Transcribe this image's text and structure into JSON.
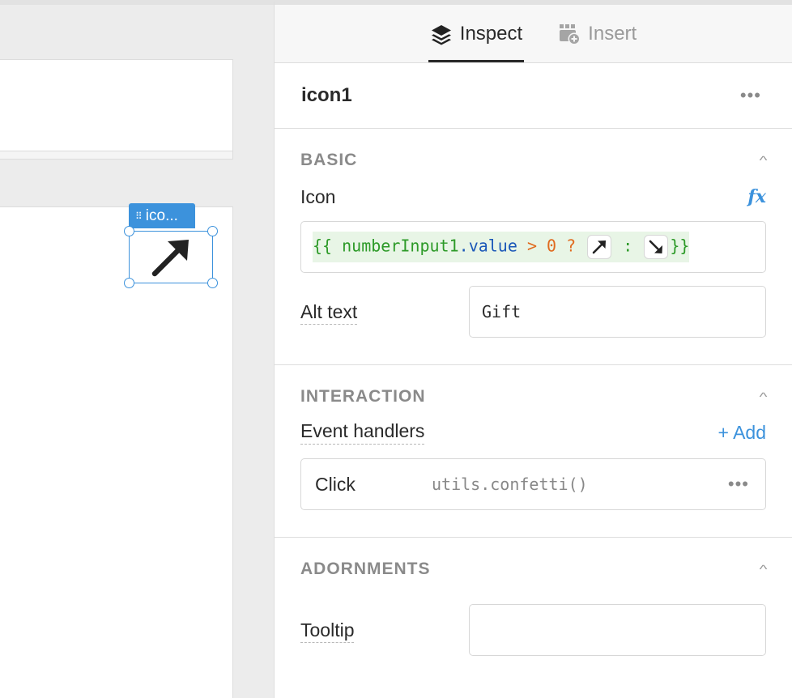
{
  "canvas": {
    "selected_tag": "ico..."
  },
  "tabs": [
    {
      "label": "Inspect",
      "icon": "layers-icon",
      "active": true
    },
    {
      "label": "Insert",
      "icon": "add-component-icon",
      "active": false
    }
  ],
  "component": {
    "name": "icon1",
    "menu": "•••"
  },
  "sections": {
    "basic": {
      "title": "BASIC",
      "icon_label": "Icon",
      "fx": "fx",
      "code": {
        "open": "{{",
        "variable": "numberInput1",
        "dot": ".",
        "property": "value",
        "op": "> 0 ?",
        "colon": ":",
        "close": "}}",
        "true_icon": "arrow-up-right-icon",
        "false_icon": "arrow-down-right-icon"
      },
      "alt_text_label": "Alt text",
      "alt_text_value": "Gift"
    },
    "interaction": {
      "title": "INTERACTION",
      "event_handlers_label": "Event handlers",
      "add_label": "+ Add",
      "handler": {
        "event": "Click",
        "action": "utils.confetti()",
        "menu": "•••"
      }
    },
    "adornments": {
      "title": "ADORNMENTS",
      "tooltip_label": "Tooltip",
      "tooltip_value": ""
    }
  },
  "colors": {
    "accent": "#3c92dc",
    "code_green": "#2d9a28",
    "code_blue": "#1b58b8",
    "code_orange": "#e06a1e"
  }
}
